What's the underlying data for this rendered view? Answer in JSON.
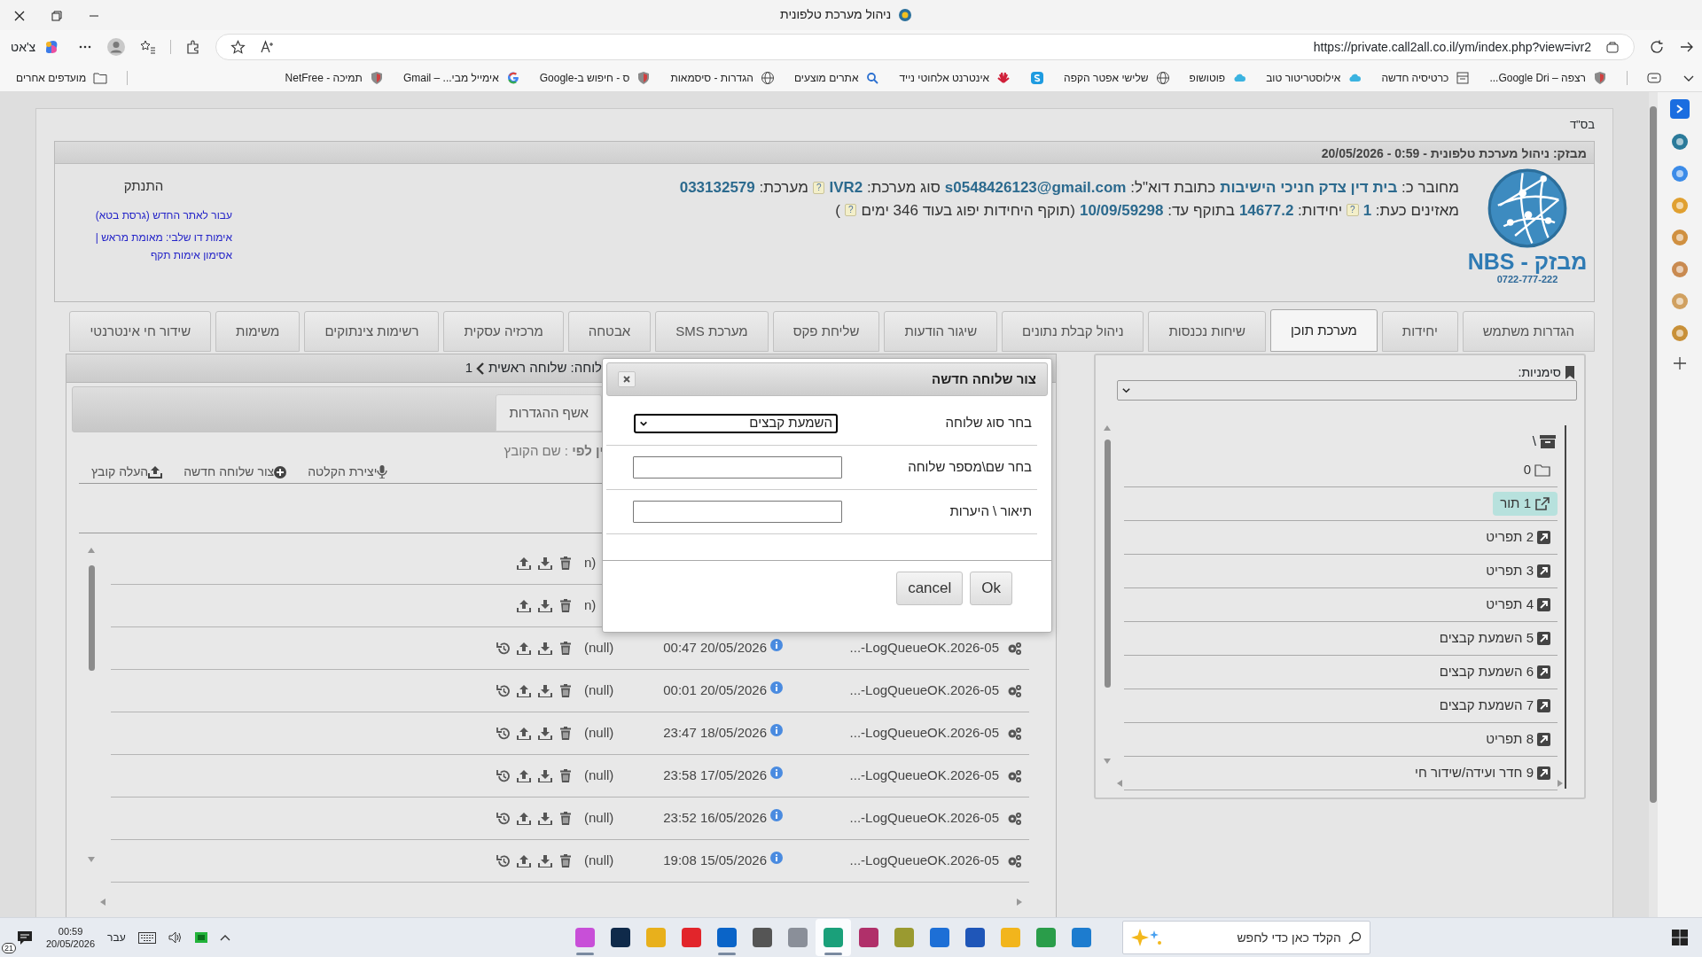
{
  "browser": {
    "title": "ניהול מערכת טלפונית",
    "chat_button": "צ'אט",
    "url": "https://private.call2all.co.il/ym/index.php?view=ivr2",
    "bookmarks": [
      {
        "label": "רצפה – Google Dri...",
        "kind": "shield"
      },
      {
        "label": "כרטיסיה חדשה",
        "kind": "page"
      },
      {
        "label": "אילוסטריטור טוב",
        "kind": "cloud"
      },
      {
        "label": "פוטושופ",
        "kind": "cloud"
      },
      {
        "label": "שלישי אפטר הקפה",
        "kind": "globe"
      },
      {
        "kind": "skype"
      },
      {
        "label": "אינטרנט אלחוטי נייד",
        "kind": "flower"
      },
      {
        "label": "אתרים מוצעים",
        "kind": "search"
      },
      {
        "label": "הגדרות - סיסמאות",
        "kind": "globe"
      },
      {
        "label": "ס - חיפוש ב-Google",
        "kind": "shield"
      },
      {
        "label": "אימייל מבי... – Gmail",
        "kind": "google"
      },
      {
        "label": "תמיכה - NetFree",
        "kind": "shield"
      }
    ],
    "other_bookmarks": "מועדפים אחרים"
  },
  "page": {
    "header_mark": "בס\"ד",
    "banner": "מבזק: ניהול מערכת טלפונית - 0:59 - 20/05/2026",
    "logo_name": "מבזק - NBS",
    "logo_phone": "0722-777-222",
    "info_lines": [
      [
        {
          "text": "מחובר כ: **בית דין צדק חניכי הישיבות**"
        },
        {
          "text": "כתובת דוא\"ל: **s0548426123@gmail.com**"
        },
        {
          "text": "סוג מערכת: **IVR2**",
          "help": "?"
        },
        {
          "text": "מערכת: **033132579**"
        }
      ],
      [
        {
          "text": "מאזינים כעת: **1**",
          "help": "?"
        },
        {
          "text": "יחידות: **14677.2**"
        },
        {
          "text": "בתוקף עד: **10/09/59298**"
        },
        {
          "text": "(תוקף היחידות יפוג בעוד 346 ימים",
          "help": "?"
        },
        {
          "text": ")"
        }
      ]
    ],
    "logout": "התנתק",
    "links": [
      "עבור לאתר החדש (גרסת בטא)",
      "אימות דו שלבי: מאומת מראש |",
      "אסימון אימות תקף"
    ]
  },
  "tabs": [
    {
      "label": "הגדרות משתמש",
      "selected": false
    },
    {
      "label": "יחידות",
      "selected": false
    },
    {
      "label": "מערכת תוכן",
      "selected": true
    },
    {
      "label": "שיחות נכנסות",
      "selected": false
    },
    {
      "label": "ניהול קבלת נתונים",
      "selected": false
    },
    {
      "label": "שיגור הודעות",
      "selected": false
    },
    {
      "label": "שליחת פקס",
      "selected": false
    },
    {
      "label": "מערכת SMS",
      "selected": false
    },
    {
      "label": "אבטחה",
      "selected": false
    },
    {
      "label": "מרכזיה עסקית",
      "selected": false
    },
    {
      "label": "רשימות צינתוקים",
      "selected": false
    },
    {
      "label": "משימות",
      "selected": false
    },
    {
      "label": "שידור חי אינטרנטי",
      "selected": false
    }
  ],
  "bookmarks_panel": {
    "label": "סימניות:",
    "tree": {
      "label": "\\",
      "children": [
        {
          "label": "0",
          "kind": "folder",
          "selected": false
        },
        {
          "label": "1 תור",
          "kind": "extension",
          "selected": true
        },
        {
          "label": "2 תפריט",
          "kind": "extension",
          "selected": false
        },
        {
          "label": "3 תפריט",
          "kind": "extension",
          "selected": false
        },
        {
          "label": "4 תפריט",
          "kind": "extension",
          "selected": false
        },
        {
          "label": "5 השמעת קבצים",
          "kind": "extension",
          "selected": false
        },
        {
          "label": "6 השמעת קבצים",
          "kind": "extension",
          "selected": false
        },
        {
          "label": "7 השמעת קבצים",
          "kind": "extension",
          "selected": false
        },
        {
          "label": "8 תפריט",
          "kind": "extension",
          "selected": false
        },
        {
          "label": "9 חדר ועידה/שידור חי",
          "kind": "extension",
          "selected": false
        }
      ]
    }
  },
  "extension_panel": {
    "path": "לוחה: שלוחה ראשית",
    "current": "1",
    "subtab": "אשף ההגדרות",
    "sort": "**ין לפי** : שם הקובץ",
    "actions": [
      {
        "label": "יצירת הקלטה",
        "kind": "mic"
      },
      {
        "label": "צור שלוחה חדשה",
        "kind": "plus"
      },
      {
        "label": "העלה קובץ",
        "kind": "upload"
      }
    ],
    "files": [
      {
        "status": "(n",
        "restorable": false
      },
      {
        "status": "(n",
        "restorable": false
      },
      {
        "name": "LogQueueOK.2026-05-...",
        "date": "20/05/2026 00:47",
        "status": "(null)",
        "restorable": true
      },
      {
        "name": "LogQueueOK.2026-05-...",
        "date": "20/05/2026 00:01",
        "status": "(null)",
        "restorable": true
      },
      {
        "name": "LogQueueOK.2026-05-...",
        "date": "18/05/2026 23:47",
        "status": "(null)",
        "restorable": true
      },
      {
        "name": "LogQueueOK.2026-05-...",
        "date": "17/05/2026 23:58",
        "status": "(null)",
        "restorable": true
      },
      {
        "name": "LogQueueOK.2026-05-...",
        "date": "16/05/2026 23:52",
        "status": "(null)",
        "restorable": true
      },
      {
        "name": "LogQueueOK.2026-05-...",
        "date": "15/05/2026 19:08",
        "status": "(null)",
        "restorable": true
      }
    ]
  },
  "dialog": {
    "title": "צור שלוחה חדשה",
    "fields": [
      {
        "label": "בחר סוג שלוחה",
        "kind": "select",
        "value": "השמעת קבצים"
      },
      {
        "label": "בחר שם\\מספר שלוחה",
        "kind": "text"
      },
      {
        "label": "תיאור \\ היערות",
        "kind": "text"
      }
    ],
    "buttons": [
      "Ok",
      "cancel"
    ]
  },
  "taskbar": {
    "notifications": "21",
    "time": "00:59",
    "date": "20/05/2026",
    "language": "עבר",
    "search_placeholder": "הקלד כאן כדי לחפש",
    "apps": [
      {
        "color": "#c84fd8",
        "running": true,
        "selected": false
      },
      {
        "color": "#0f2a4a",
        "running": false,
        "selected": false
      },
      {
        "color": "#e8b01c",
        "running": false,
        "selected": false
      },
      {
        "color": "#e2252b",
        "running": false,
        "selected": false
      },
      {
        "color": "#0a64c8",
        "running": true,
        "selected": false
      },
      {
        "color": "#555555",
        "running": false,
        "selected": false
      },
      {
        "color": "#8a8f99",
        "running": false,
        "selected": false
      },
      {
        "color": "#1aa07a",
        "running": true,
        "selected": true
      },
      {
        "color": "#b0306a",
        "running": false,
        "selected": false
      },
      {
        "color": "#9a9a30",
        "running": false,
        "selected": false
      },
      {
        "color": "#1d6fd6",
        "running": false,
        "selected": false
      },
      {
        "color": "#1f56b8",
        "running": false,
        "selected": false
      },
      {
        "color": "#f2b51c",
        "running": false,
        "selected": false
      },
      {
        "color": "#2a9d4a",
        "running": false,
        "selected": false
      },
      {
        "color": "#1d7ccf",
        "running": false,
        "selected": false
      }
    ]
  }
}
